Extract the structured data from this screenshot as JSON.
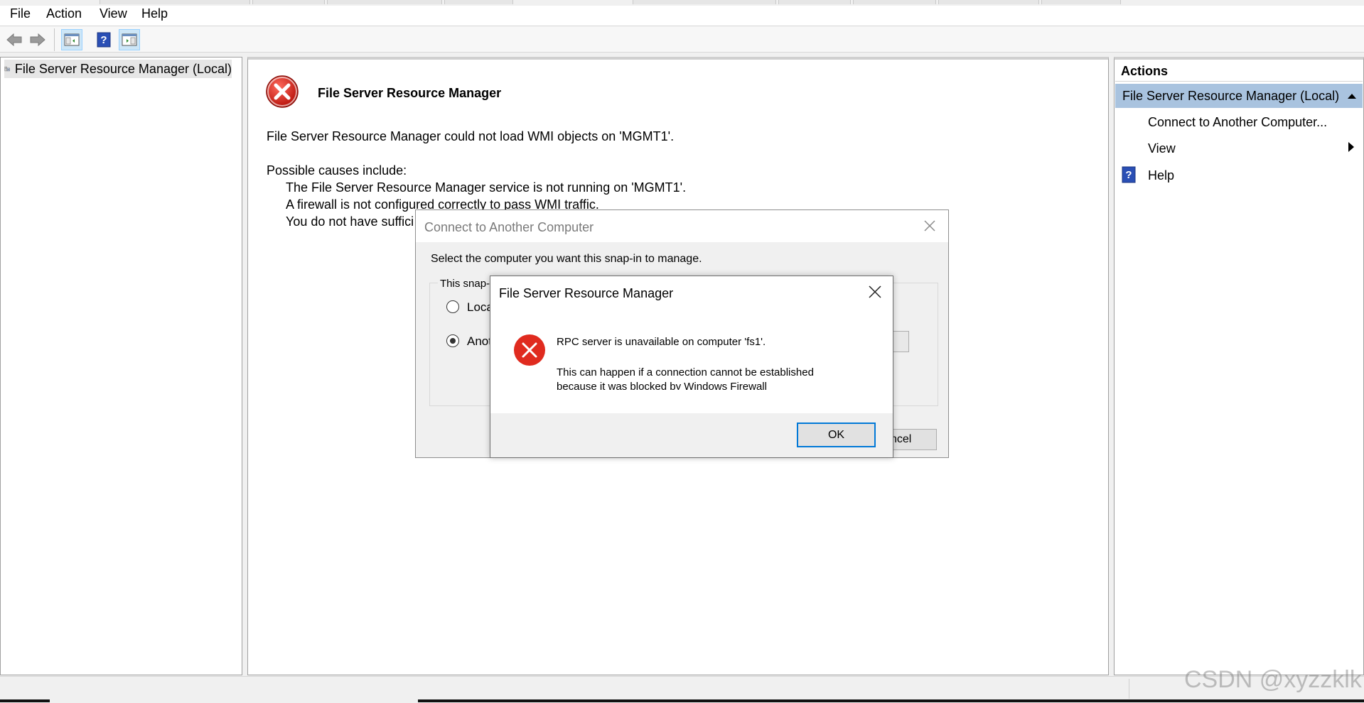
{
  "menu": {
    "file": "File",
    "action": "Action",
    "view": "View",
    "help": "Help"
  },
  "toolbar": {
    "icons": [
      "back-arrow-icon",
      "forward-arrow-icon",
      "show-hide-console-tree-icon",
      "help-icon",
      "show-hide-action-pane-icon"
    ]
  },
  "tree": {
    "root_label": "File Server Resource Manager (Local)"
  },
  "center": {
    "title": "File Server Resource Manager",
    "message": "File Server Resource Manager could not load WMI objects on 'MGMT1'.",
    "causes_heading": "Possible causes include:",
    "cause_1": "The File Server Resource Manager service is not running on 'MGMT1'.",
    "cause_2": "A firewall is not configured correctly to pass WMI traffic.",
    "cause_3": "You do not have suffici"
  },
  "actions": {
    "heading": "Actions",
    "selected": "File Server Resource Manager (Local)",
    "connect": "Connect to Another Computer...",
    "view": "View",
    "help": "Help"
  },
  "connect_dialog": {
    "title": "Connect to Another Computer",
    "prompt": "Select the computer you want this snap-in to manage.",
    "group_label": "This snap-",
    "radio_local": "Loca",
    "radio_another": "Anot",
    "cancel_label": "ncel"
  },
  "error_dialog": {
    "title": "File Server Resource Manager",
    "message": "RPC server is unavailable on computer 'fs1'.",
    "detail_line_1": "This can happen if a connection cannot be established",
    "detail_line_2": "because it was blocked by Windows Firewall",
    "ok_label": "OK"
  },
  "watermark": "CSDN @xyzzklk",
  "colors": {
    "selection": "#a9c3df",
    "error_red": "#e02b1f",
    "ok_border": "#0078d7"
  }
}
